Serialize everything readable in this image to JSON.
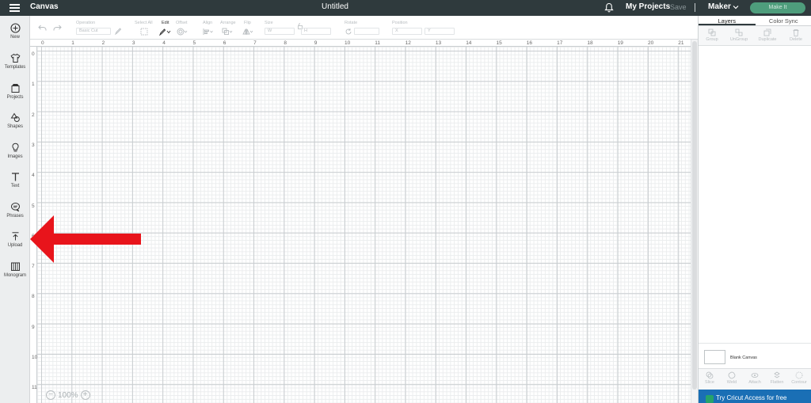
{
  "header": {
    "app_title": "Canvas",
    "doc_title": "Untitled",
    "my_projects": "My Projects",
    "save": "Save",
    "machine": "Maker",
    "make_button": "Make It"
  },
  "sidebar": {
    "items": [
      {
        "label": "New",
        "icon": "plus-circle-icon"
      },
      {
        "label": "Templates",
        "icon": "shirt-icon"
      },
      {
        "label": "Projects",
        "icon": "projects-icon"
      },
      {
        "label": "Shapes",
        "icon": "shapes-icon"
      },
      {
        "label": "Images",
        "icon": "lightbulb-icon"
      },
      {
        "label": "Text",
        "icon": "text-icon"
      },
      {
        "label": "Phrases",
        "icon": "speech-bubble-icon"
      },
      {
        "label": "Upload",
        "icon": "upload-icon"
      },
      {
        "label": "Monogram",
        "icon": "monogram-icon"
      }
    ]
  },
  "toolbar": {
    "operation_label": "Operation",
    "operation_value": "Basic Cut",
    "select_all": "Select All",
    "edit": "Edit",
    "offset": "Offset",
    "align": "Align",
    "arrange": "Arrange",
    "flip": "Flip",
    "size": "Size",
    "size_w": "W",
    "size_h": "H",
    "rotate": "Rotate",
    "position": "Position",
    "pos_x": "X",
    "pos_y": "Y"
  },
  "ruler": {
    "x": [
      "0",
      "1",
      "2",
      "3",
      "4",
      "5",
      "6",
      "7",
      "8",
      "9",
      "10",
      "11",
      "12",
      "13",
      "14",
      "15",
      "16",
      "17",
      "18",
      "19",
      "20",
      "21"
    ],
    "y": [
      "0",
      "1",
      "2",
      "3",
      "4",
      "5",
      "6",
      "7",
      "8",
      "9",
      "10",
      "11"
    ]
  },
  "zoom": {
    "minus": "−",
    "value": "100%",
    "plus": "+"
  },
  "right_panel": {
    "tabs": [
      "Layers",
      "Color Sync"
    ],
    "actions": [
      "Group",
      "UnGroup",
      "Duplicate",
      "Delete"
    ],
    "blank_canvas": "Blank Canvas",
    "bottom_actions": [
      "Slice",
      "Weld",
      "Attach",
      "Flatten",
      "Contour"
    ],
    "promo": "Try Cricut Access for free"
  },
  "colors": {
    "topbar": "#2f3a3d",
    "make_button": "#4e9d7c",
    "arrow": "#e8141b",
    "promo": "#1a6fb5"
  }
}
